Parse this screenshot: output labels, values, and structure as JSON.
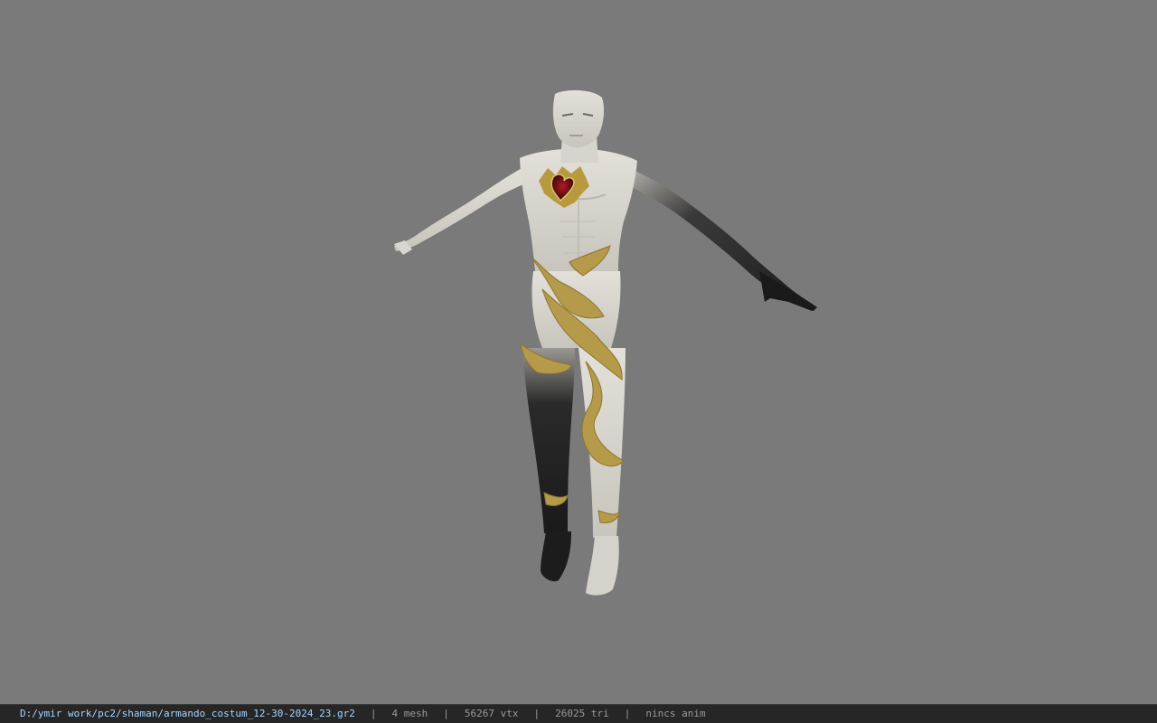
{
  "viewport": {
    "background_color": "#7a7a7a",
    "model_description_icon": "character-model"
  },
  "status_bar": {
    "file_path": "D:/ymir work/pc2/shaman/armando_costum_12-30-2024_23.gr2",
    "separator": "|",
    "mesh_count": "4 mesh",
    "vertex_count": "56267 vtx",
    "triangle_count": "26025 tri",
    "anim_status": "nincs anim",
    "path_color": "#a8d4ff",
    "info_color": "#9a9a9a",
    "background_color": "#262626"
  }
}
